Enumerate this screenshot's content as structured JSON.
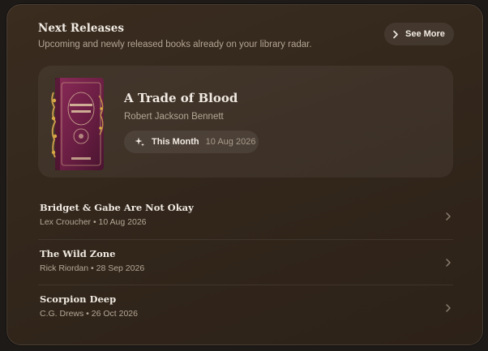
{
  "header": {
    "title": "Next Releases",
    "subtitle": "Upcoming and newly released books already on your library radar.",
    "see_more_label": "See More"
  },
  "featured": {
    "title": "A Trade of Blood",
    "author": "Robert Jackson Bennett",
    "badge_label": "This Month",
    "date": "10 Aug 2026",
    "cover_icon": "book-cover"
  },
  "releases": [
    {
      "title": "Bridget & Gabe Are Not Okay",
      "meta": "Lex Croucher • 10 Aug 2026"
    },
    {
      "title": "The Wild Zone",
      "meta": "Rick Riordan • 28 Sep 2026"
    },
    {
      "title": "Scorpion Deep",
      "meta": "C.G. Drews • 26 Oct 2026"
    }
  ],
  "colors": {
    "card_bg": "#33271c",
    "text_primary": "#f1ebe3",
    "text_secondary": "#b3a796",
    "cover_purple": "#6e1f45"
  }
}
